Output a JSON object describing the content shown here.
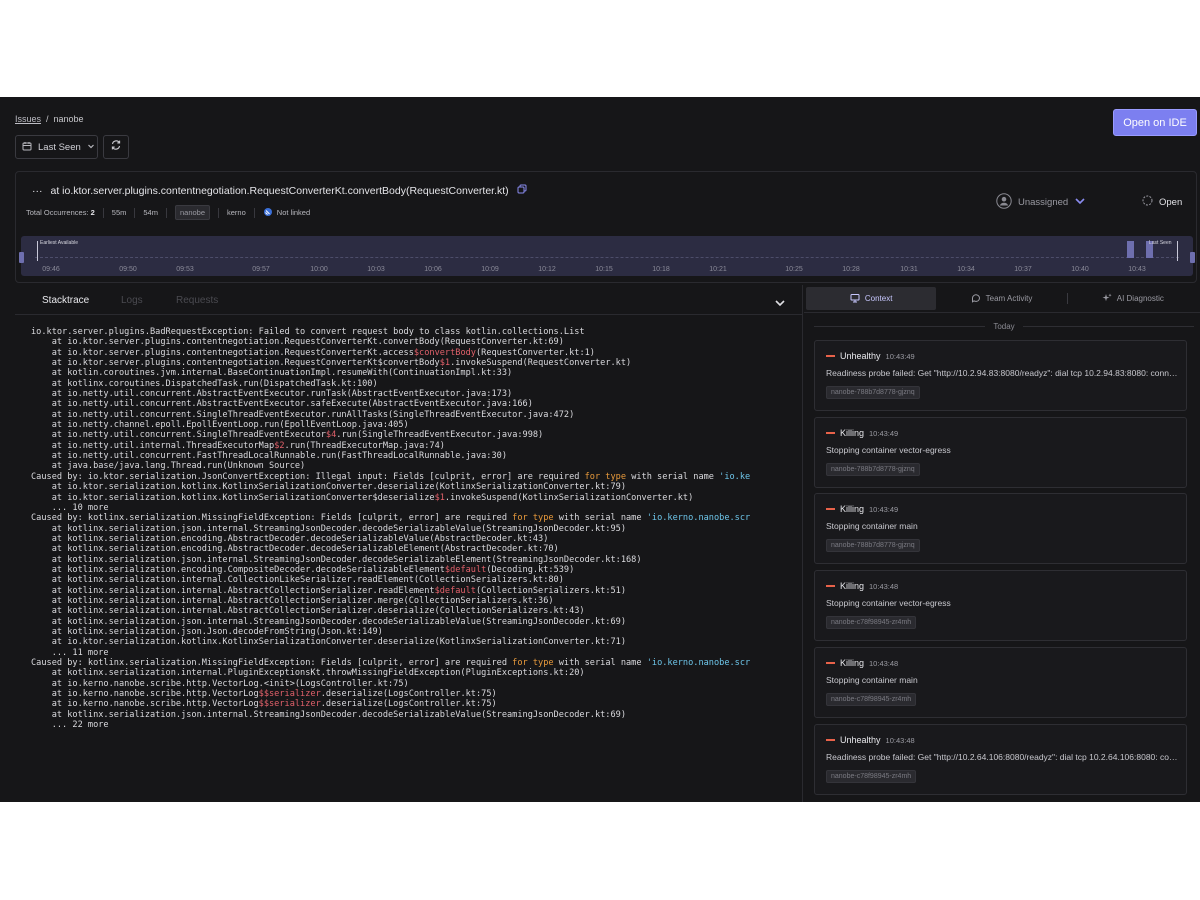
{
  "breadcrumb": {
    "issues": "Issues",
    "sep": "/",
    "current": "nanobe"
  },
  "toolbar": {
    "open_ide": "Open on IDE",
    "last_seen": "Last Seen"
  },
  "issue": {
    "menu": "···",
    "title": "at io.ktor.server.plugins.contentnegotiation.RequestConverterKt.convertBody(RequestConverter.kt)",
    "occ_label": "Total Occurrences:",
    "occ_value": "2",
    "age1": "55m",
    "age2": "54m",
    "service": "nanobe",
    "org": "kerno",
    "link": "Not linked",
    "assignee": "Unassigned",
    "status": "Open"
  },
  "timeline": {
    "earliest": "Earliest Available",
    "latest": "Last Seen",
    "ticks": [
      "09:46",
      "09:50",
      "09:53",
      "09:57",
      "10:00",
      "10:03",
      "10:06",
      "10:09",
      "10:12",
      "10:15",
      "10:18",
      "10:21",
      "10:25",
      "10:28",
      "10:31",
      "10:34",
      "10:37",
      "10:40",
      "10:43"
    ]
  },
  "tabs": {
    "stacktrace": "Stacktrace",
    "logs": "Logs",
    "requests": "Requests"
  },
  "stack": [
    [
      [
        "",
        "io.ktor.server.plugins.BadRequestException: Failed to convert request body to class kotlin.collections.List"
      ]
    ],
    [
      [
        "",
        "    at io.ktor.server.plugins.contentnegotiation.RequestConverterKt.convertBody(RequestConverter.kt:69)"
      ]
    ],
    [
      [
        "",
        "    at io.ktor.server.plugins.contentnegotiation.RequestConverterKt.access"
      ],
      [
        "r",
        "$convertBody"
      ],
      [
        "",
        "(RequestConverter.kt:1)"
      ]
    ],
    [
      [
        "",
        "    at io.ktor.server.plugins.contentnegotiation.RequestConverterKt$convertBody"
      ],
      [
        "r",
        "$1"
      ],
      [
        "",
        ".invokeSuspend(RequestConverter.kt)"
      ]
    ],
    [
      [
        "",
        "    at kotlin.coroutines.jvm.internal.BaseContinuationImpl.resumeWith(ContinuationImpl.kt:33)"
      ]
    ],
    [
      [
        "",
        "    at kotlinx.coroutines.DispatchedTask.run(DispatchedTask.kt:100)"
      ]
    ],
    [
      [
        "",
        "    at io.netty.util.concurrent.AbstractEventExecutor.runTask(AbstractEventExecutor.java:173)"
      ]
    ],
    [
      [
        "",
        "    at io.netty.util.concurrent.AbstractEventExecutor.safeExecute(AbstractEventExecutor.java:166)"
      ]
    ],
    [
      [
        "",
        "    at io.netty.util.concurrent.SingleThreadEventExecutor.runAllTasks(SingleThreadEventExecutor.java:472)"
      ]
    ],
    [
      [
        "",
        "    at io.netty.channel.epoll.EpollEventLoop.run(EpollEventLoop.java:405)"
      ]
    ],
    [
      [
        "",
        "    at io.netty.util.concurrent.SingleThreadEventExecutor"
      ],
      [
        "r",
        "$4"
      ],
      [
        "",
        ".run(SingleThreadEventExecutor.java:998)"
      ]
    ],
    [
      [
        "",
        "    at io.netty.util.internal.ThreadExecutorMap"
      ],
      [
        "r",
        "$2"
      ],
      [
        "",
        ".run(ThreadExecutorMap.java:74)"
      ]
    ],
    [
      [
        "",
        "    at io.netty.util.concurrent.FastThreadLocalRunnable.run(FastThreadLocalRunnable.java:30)"
      ]
    ],
    [
      [
        "",
        "    at java.base/java.lang.Thread.run(Unknown Source)"
      ]
    ],
    [
      [
        "",
        "Caused by: io.ktor.serialization.JsonConvertException: Illegal input: Fields [culprit, error] are required "
      ],
      [
        "o",
        "for type"
      ],
      [
        "",
        " with serial name "
      ],
      [
        "b",
        "'io.ke"
      ]
    ],
    [
      [
        "",
        "    at io.ktor.serialization.kotlinx.KotlinxSerializationConverter.deserialize(KotlinxSerializationConverter.kt:79)"
      ]
    ],
    [
      [
        "",
        "    at io.ktor.serialization.kotlinx.KotlinxSerializationConverter$deserialize"
      ],
      [
        "r",
        "$1"
      ],
      [
        "",
        ".invokeSuspend(KotlinxSerializationConverter.kt)"
      ]
    ],
    [
      [
        "",
        "    ... 10 more"
      ]
    ],
    [
      [
        "",
        "Caused by: kotlinx.serialization.MissingFieldException: Fields [culprit, error] are required "
      ],
      [
        "o",
        "for type"
      ],
      [
        "",
        " with serial name "
      ],
      [
        "b",
        "'io.kerno.nanobe.scr"
      ]
    ],
    [
      [
        "",
        "    at kotlinx.serialization.json.internal.StreamingJsonDecoder.decodeSerializableValue(StreamingJsonDecoder.kt:95)"
      ]
    ],
    [
      [
        "",
        "    at kotlinx.serialization.encoding.AbstractDecoder.decodeSerializableValue(AbstractDecoder.kt:43)"
      ]
    ],
    [
      [
        "",
        "    at kotlinx.serialization.encoding.AbstractDecoder.decodeSerializableElement(AbstractDecoder.kt:70)"
      ]
    ],
    [
      [
        "",
        "    at kotlinx.serialization.json.internal.StreamingJsonDecoder.decodeSerializableElement(StreamingJsonDecoder.kt:168)"
      ]
    ],
    [
      [
        "",
        "    at kotlinx.serialization.encoding.CompositeDecoder.decodeSerializableElement"
      ],
      [
        "r",
        "$default"
      ],
      [
        "",
        "(Decoding.kt:539)"
      ]
    ],
    [
      [
        "",
        "    at kotlinx.serialization.internal.CollectionLikeSerializer.readElement(CollectionSerializers.kt:80)"
      ]
    ],
    [
      [
        "",
        "    at kotlinx.serialization.internal.AbstractCollectionSerializer.readElement"
      ],
      [
        "r",
        "$default"
      ],
      [
        "",
        "(CollectionSerializers.kt:51)"
      ]
    ],
    [
      [
        "",
        "    at kotlinx.serialization.internal.AbstractCollectionSerializer.merge(CollectionSerializers.kt:36)"
      ]
    ],
    [
      [
        "",
        "    at kotlinx.serialization.internal.AbstractCollectionSerializer.deserialize(CollectionSerializers.kt:43)"
      ]
    ],
    [
      [
        "",
        "    at kotlinx.serialization.json.internal.StreamingJsonDecoder.decodeSerializableValue(StreamingJsonDecoder.kt:69)"
      ]
    ],
    [
      [
        "",
        "    at kotlinx.serialization.json.Json.decodeFromString(Json.kt:149)"
      ]
    ],
    [
      [
        "",
        "    at io.ktor.serialization.kotlinx.KotlinxSerializationConverter.deserialize(KotlinxSerializationConverter.kt:71)"
      ]
    ],
    [
      [
        "",
        "    ... 11 more"
      ]
    ],
    [
      [
        "",
        "Caused by: kotlinx.serialization.MissingFieldException: Fields [culprit, error] are required "
      ],
      [
        "o",
        "for type"
      ],
      [
        "",
        " with serial name "
      ],
      [
        "b",
        "'io.kerno.nanobe.scr"
      ]
    ],
    [
      [
        "",
        "    at kotlinx.serialization.internal.PluginExceptionsKt.throwMissingFieldException(PluginExceptions.kt:20)"
      ]
    ],
    [
      [
        "",
        "    at io.kerno.nanobe.scribe.http.VectorLog.<init>(LogsController.kt:75)"
      ]
    ],
    [
      [
        "",
        "    at io.kerno.nanobe.scribe.http.VectorLog"
      ],
      [
        "r",
        "$$serializer"
      ],
      [
        "",
        ".deserialize(LogsController.kt:75)"
      ]
    ],
    [
      [
        "",
        "    at io.kerno.nanobe.scribe.http.VectorLog"
      ],
      [
        "r",
        "$$serializer"
      ],
      [
        "",
        ".deserialize(LogsController.kt:75)"
      ]
    ],
    [
      [
        "",
        "    at kotlinx.serialization.json.internal.StreamingJsonDecoder.decodeSerializableValue(StreamingJsonDecoder.kt:69)"
      ]
    ],
    [
      [
        "",
        "    ... 22 more"
      ]
    ]
  ],
  "right": {
    "tabs": [
      "Context",
      "Team Activity",
      "AI Diagnostic"
    ],
    "today": "Today",
    "events": [
      {
        "type": "Unhealthy",
        "time": "10:43:49",
        "msg": "Readiness probe failed: Get \"http://10.2.94.83:8080/readyz\": dial tcp 10.2.94.83:8080: connect: connection refused",
        "pod": "nanobe-788b7d8778-gjznq"
      },
      {
        "type": "Killing",
        "time": "10:43:49",
        "msg": "Stopping container vector-egress",
        "pod": "nanobe-788b7d8778-gjznq"
      },
      {
        "type": "Killing",
        "time": "10:43:49",
        "msg": "Stopping container main",
        "pod": "nanobe-788b7d8778-gjznq"
      },
      {
        "type": "Killing",
        "time": "10:43:48",
        "msg": "Stopping container vector-egress",
        "pod": "nanobe-c78f98945-zr4mh"
      },
      {
        "type": "Killing",
        "time": "10:43:48",
        "msg": "Stopping container main",
        "pod": "nanobe-c78f98945-zr4mh"
      },
      {
        "type": "Unhealthy",
        "time": "10:43:48",
        "msg": "Readiness probe failed: Get \"http://10.2.64.106:8080/readyz\": dial tcp 10.2.64.106:8080: connect: connection refused",
        "pod": "nanobe-c78f98945-zr4mh"
      }
    ]
  },
  "colors": {
    "accent": "#7c7ff0",
    "event_marker": "#e8624a",
    "code_red": "#e0606a",
    "code_orange": "#e89a3c",
    "code_blue": "#6ec6ea"
  }
}
